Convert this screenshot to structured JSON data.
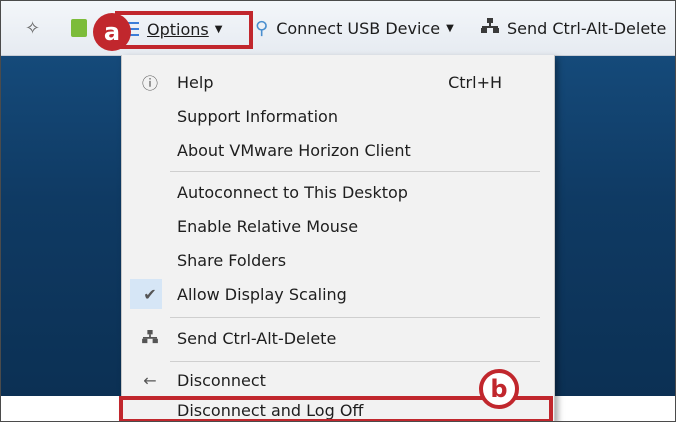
{
  "toolbar": {
    "pin_icon": "pin-icon",
    "options_label": "Options",
    "usb_label": "Connect USB Device",
    "cad_label": "Send Ctrl-Alt-Delete"
  },
  "badges": {
    "a": "a",
    "b": "b"
  },
  "menu": {
    "items": [
      {
        "label": "Help",
        "shortcut": "Ctrl+H",
        "icon": "help-icon"
      },
      {
        "label": "Support Information"
      },
      {
        "label": "About VMware Horizon Client"
      },
      {
        "label": "Autoconnect to This Desktop"
      },
      {
        "label": "Enable Relative Mouse"
      },
      {
        "label": "Share Folders"
      },
      {
        "label": "Allow Display Scaling",
        "checked": true
      },
      {
        "label": "Send Ctrl-Alt-Delete",
        "icon": "network-icon"
      },
      {
        "label": "Disconnect",
        "icon": "back-arrow-icon"
      },
      {
        "label": "Disconnect and Log Off"
      }
    ]
  },
  "colors": {
    "highlight": "#c1272d",
    "accent": "#2f7fd0"
  }
}
